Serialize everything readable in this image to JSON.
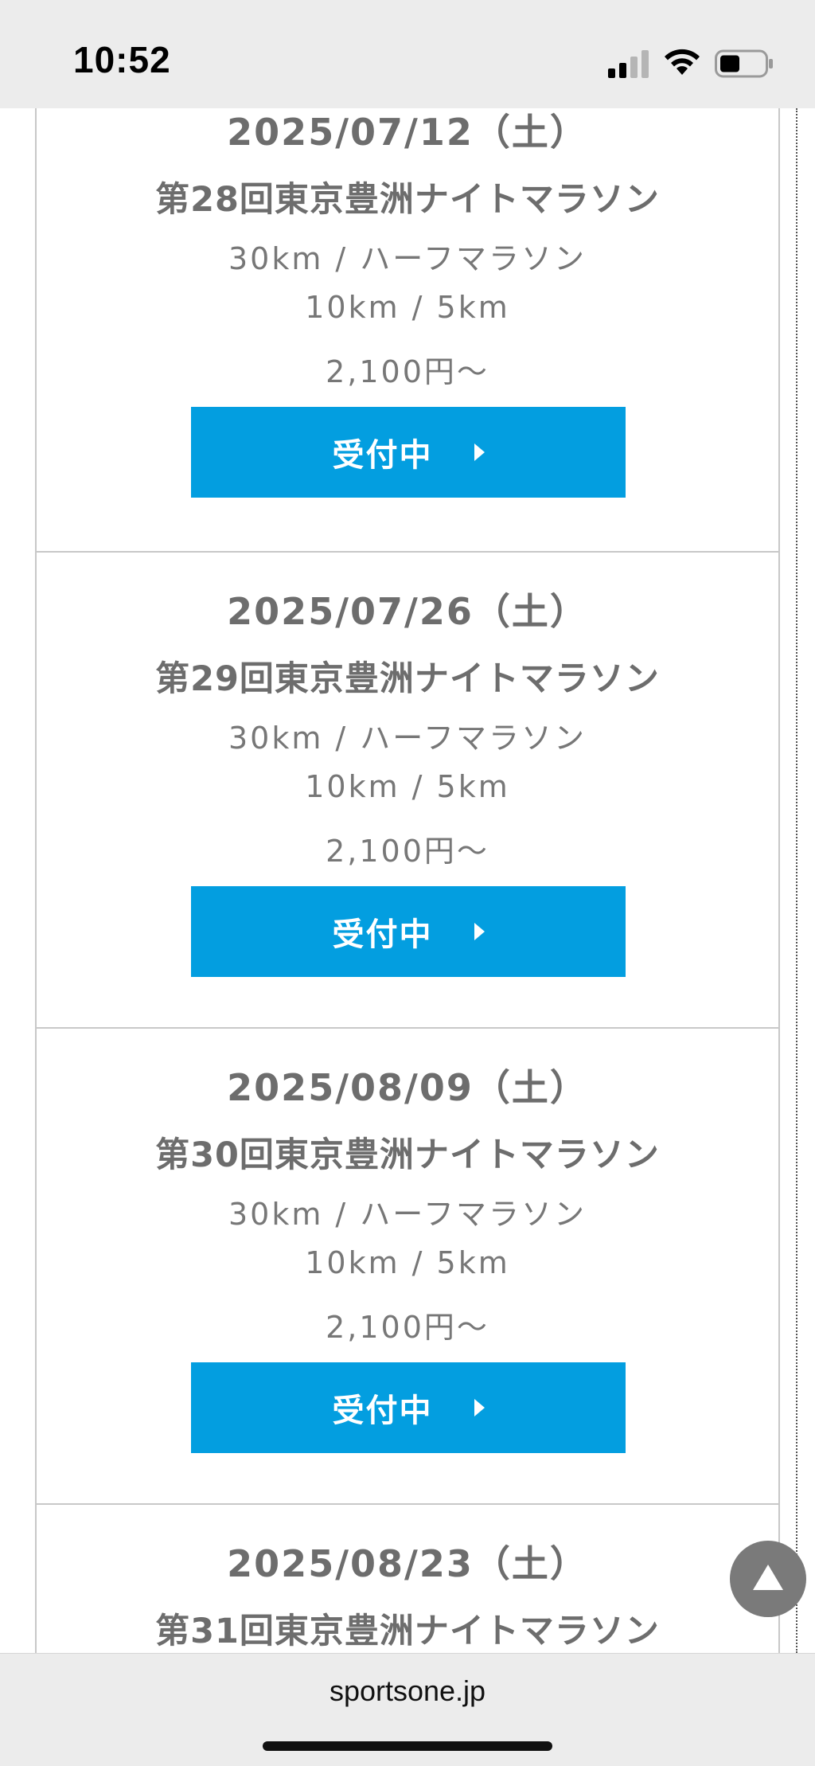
{
  "status_bar": {
    "time": "10:52"
  },
  "events": [
    {
      "date": "2025/07/12（土）",
      "title": "第28回東京豊洲ナイトマラソン",
      "distances_1": "30km / ハーフマラソン",
      "distances_2": "10km / 5km",
      "price": "2,100円～",
      "button": "受付中"
    },
    {
      "date": "2025/07/26（土）",
      "title": "第29回東京豊洲ナイトマラソン",
      "distances_1": "30km / ハーフマラソン",
      "distances_2": "10km / 5km",
      "price": "2,100円～",
      "button": "受付中"
    },
    {
      "date": "2025/08/09（土）",
      "title": "第30回東京豊洲ナイトマラソン",
      "distances_1": "30km / ハーフマラソン",
      "distances_2": "10km / 5km",
      "price": "2,100円～",
      "button": "受付中"
    },
    {
      "date": "2025/08/23（土）",
      "title": "第31回東京豊洲ナイトマラソン"
    }
  ],
  "url_bar": {
    "domain": "sportsone.jp"
  },
  "icons": {
    "signal": "cellular-signal-icon",
    "wifi": "wifi-icon",
    "battery": "battery-icon",
    "scroll_top": "triangle-up-icon"
  },
  "colors": {
    "accent": "#039ee0",
    "text_gray": "#6d6d6d"
  }
}
